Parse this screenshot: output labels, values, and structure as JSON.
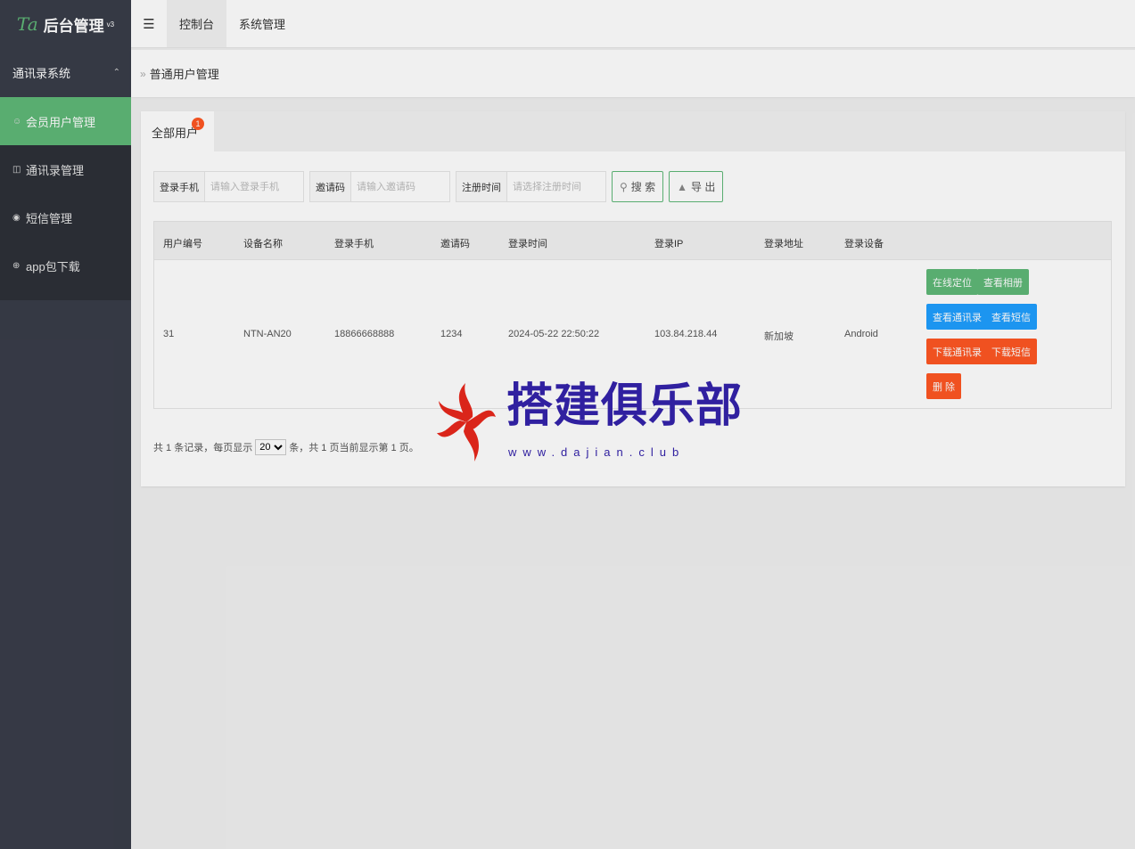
{
  "sidebar": {
    "logo_mark": "Ta",
    "title": "后台管理",
    "version": "v3",
    "group": "通讯录系统",
    "items": [
      {
        "label": "会员用户管理",
        "icon": "user-icon"
      },
      {
        "label": "通讯录管理",
        "icon": "contacts-icon"
      },
      {
        "label": "短信管理",
        "icon": "sms-icon"
      },
      {
        "label": "app包下载",
        "icon": "download-icon"
      }
    ]
  },
  "header": {
    "tabs": [
      "控制台",
      "系统管理"
    ]
  },
  "breadcrumb": "普通用户管理",
  "card": {
    "tab_label": "全部用户",
    "tab_badge": "1"
  },
  "search": {
    "phone_label": "登录手机",
    "phone_placeholder": "请输入登录手机",
    "invite_label": "邀请码",
    "invite_placeholder": "请输入邀请码",
    "time_label": "注册时间",
    "time_placeholder": "请选择注册时间",
    "search_btn": "搜 索",
    "export_btn": "导 出"
  },
  "table": {
    "columns": [
      "用户编号",
      "设备名称",
      "登录手机",
      "邀请码",
      "登录时间",
      "登录IP",
      "登录地址",
      "登录设备"
    ],
    "rows": [
      {
        "id": "31",
        "device": "NTN-AN20",
        "phone": "18866668888",
        "invite": "1234",
        "time": "2024-05-22 22:50:22",
        "ip": "103.84.218.44",
        "addr": "新加坡",
        "os": "Android"
      }
    ],
    "actions": {
      "locate": "在线定位",
      "album": "查看相册",
      "view_contacts": "查看通讯录",
      "view_sms": "查看短信",
      "dl_contacts": "下载通讯录",
      "dl_sms": "下载短信",
      "delete": "删 除"
    }
  },
  "pager": {
    "prefix": "共 1 条记录，每页显示",
    "page_size": "20",
    "suffix": "条，共 1 页当前显示第 1 页。"
  },
  "watermark": {
    "text": "搭建俱乐部",
    "url": "www.dajian.club"
  },
  "colors": {
    "sidebar": "#393d49",
    "accent": "#5fb878",
    "blue": "#1e9fff",
    "orange": "#ff5722"
  }
}
